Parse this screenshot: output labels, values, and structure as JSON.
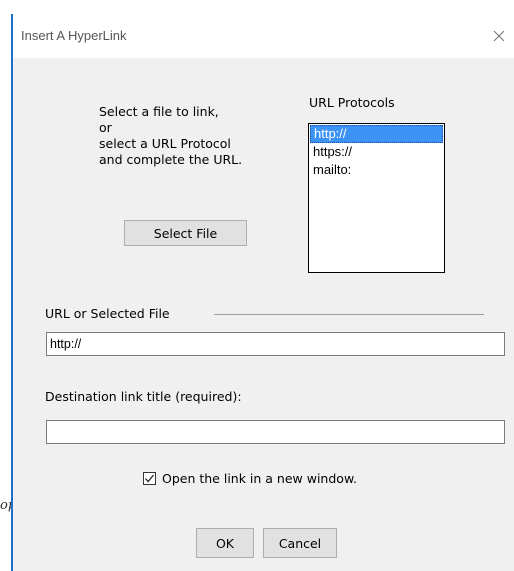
{
  "background": {
    "fragment_text": "op"
  },
  "dialog": {
    "title": "Insert A HyperLink",
    "close_icon": "close-icon",
    "accent_color": "#1f6fd1",
    "instructions": {
      "line1": "Select a file to link,",
      "line2": "or",
      "line3": "select a URL Protocol",
      "line4": "and complete the URL."
    },
    "select_file_label": "Select File",
    "url_protocols": {
      "label": "URL Protocols",
      "items": [
        "http://",
        "https://",
        "mailto:"
      ],
      "selected": "http://",
      "selection_color": "#3c92f5"
    },
    "url_group_label": "URL or Selected File",
    "url_value": "http://",
    "destination_label": "Destination link title (required):",
    "destination_value": "",
    "new_window": {
      "label": "Open the link in a new window.",
      "checked": true
    },
    "ok_label": "OK",
    "cancel_label": "Cancel"
  }
}
